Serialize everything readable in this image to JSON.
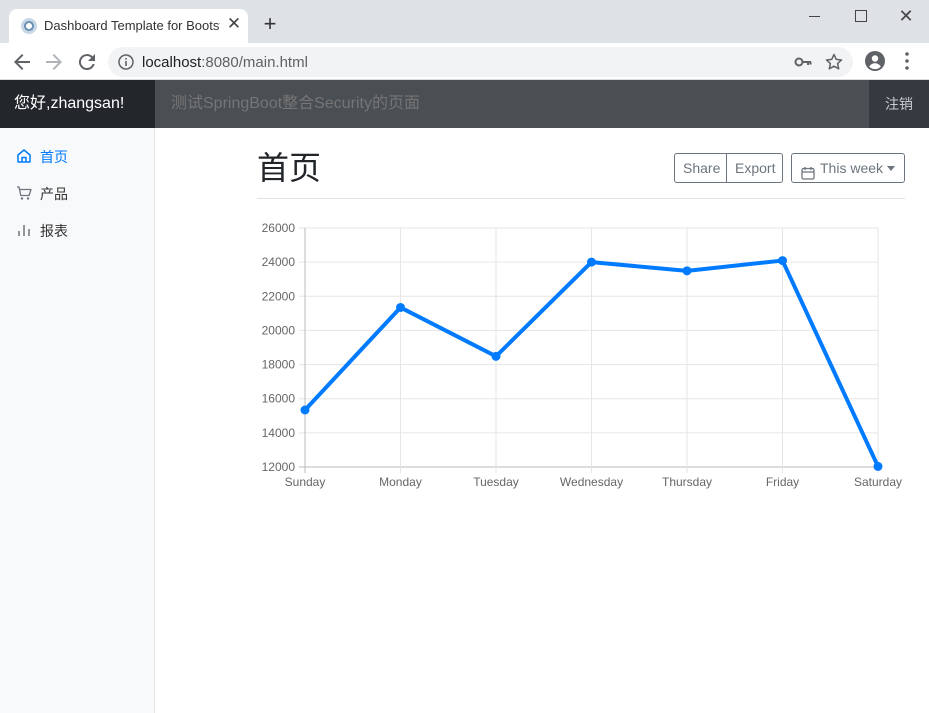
{
  "browser": {
    "tab_title": "Dashboard Template for Bootstrap",
    "url_host": "localhost",
    "url_rest": ":8080/main.html",
    "new_tab_symbol": "+",
    "close_symbol": "✕"
  },
  "navbar": {
    "brand": "您好,zhangsan!",
    "search_placeholder": "测试SpringBoot整合Security的页面",
    "signout": "注销"
  },
  "sidebar": {
    "items": [
      {
        "label": "首页",
        "icon": "home-icon",
        "active": true
      },
      {
        "label": "产品",
        "icon": "shopping-cart-icon",
        "active": false
      },
      {
        "label": "报表",
        "icon": "bar-chart-icon",
        "active": false
      }
    ]
  },
  "main": {
    "title": "首页",
    "share": "Share",
    "export": "Export",
    "period": "This week"
  },
  "colors": {
    "accent": "#007bff",
    "navbar": "#343a40",
    "sidebar_bg": "#f8f9fa"
  },
  "chart_data": {
    "type": "line",
    "categories": [
      "Sunday",
      "Monday",
      "Tuesday",
      "Wednesday",
      "Thursday",
      "Friday",
      "Saturday"
    ],
    "values": [
      15339,
      21345,
      18483,
      24003,
      23489,
      24092,
      12034
    ],
    "ylim": [
      12000,
      26000
    ],
    "yticks": [
      12000,
      14000,
      16000,
      18000,
      20000,
      22000,
      24000,
      26000
    ],
    "grid": true,
    "legend": "none",
    "line_color": "#007bff"
  }
}
